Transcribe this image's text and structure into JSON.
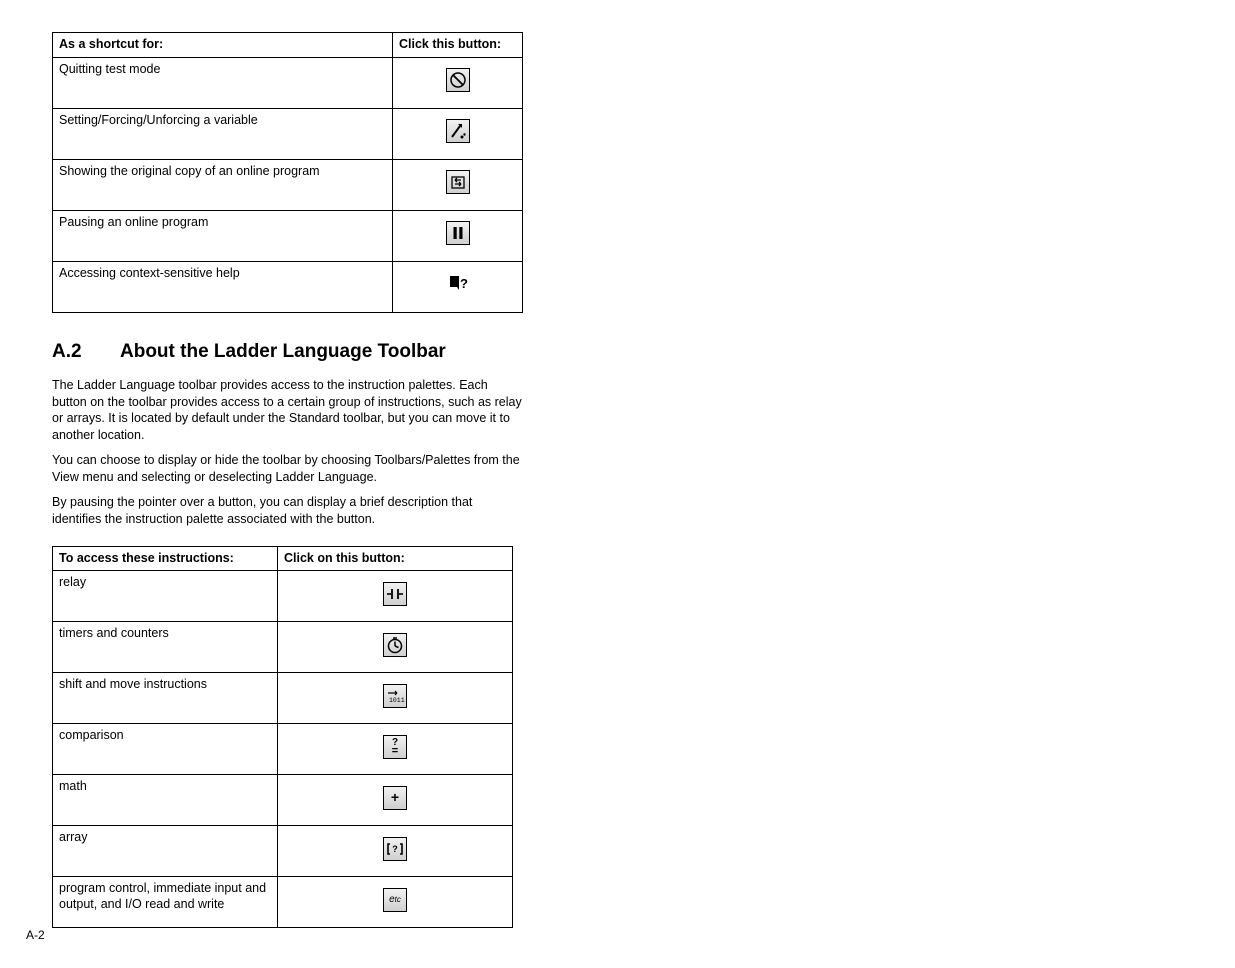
{
  "footer": "A-2",
  "table1": {
    "headers": {
      "c1": "As a shortcut for:",
      "c2": "Click this button:"
    },
    "rows": [
      {
        "label": "Quitting test mode",
        "icon": "quit-test-icon"
      },
      {
        "label": "Setting/Forcing/Unforcing a variable",
        "icon": "force-var-icon"
      },
      {
        "label": "Showing the original copy of an online program",
        "icon": "original-copy-icon"
      },
      {
        "label": "Pausing an online program",
        "icon": "pause-icon"
      },
      {
        "label": "Accessing context-sensitive help",
        "icon": "help-icon"
      }
    ]
  },
  "section": {
    "number": "A.2",
    "title": "About the Ladder Language Toolbar",
    "p1": "The Ladder Language toolbar provides access to the instruction palettes. Each button on the toolbar provides access to a certain group of instructions, such as relay or arrays. It is located by default under the Standard toolbar, but you can move it to another location.",
    "p2": "You can choose to display or hide the toolbar by choosing Toolbars/Palettes from the View menu and selecting or deselecting Ladder Language.",
    "p3": "By pausing the pointer over a button, you can display a brief description that identifies the instruction palette associated with the button."
  },
  "table2": {
    "headers": {
      "c1": "To access these instructions:",
      "c2": "Click on this button:"
    },
    "rows": [
      {
        "label": "relay",
        "icon": "relay-icon"
      },
      {
        "label": "timers and counters",
        "icon": "timer-icon"
      },
      {
        "label": "shift and move instructions",
        "icon": "shift-move-icon"
      },
      {
        "label": "comparison",
        "icon": "compare-icon"
      },
      {
        "label": "math",
        "icon": "math-icon"
      },
      {
        "label": "array",
        "icon": "array-icon"
      },
      {
        "label": "program control, immediate input and output, and I/O read and write",
        "icon": "program-control-icon"
      }
    ]
  }
}
